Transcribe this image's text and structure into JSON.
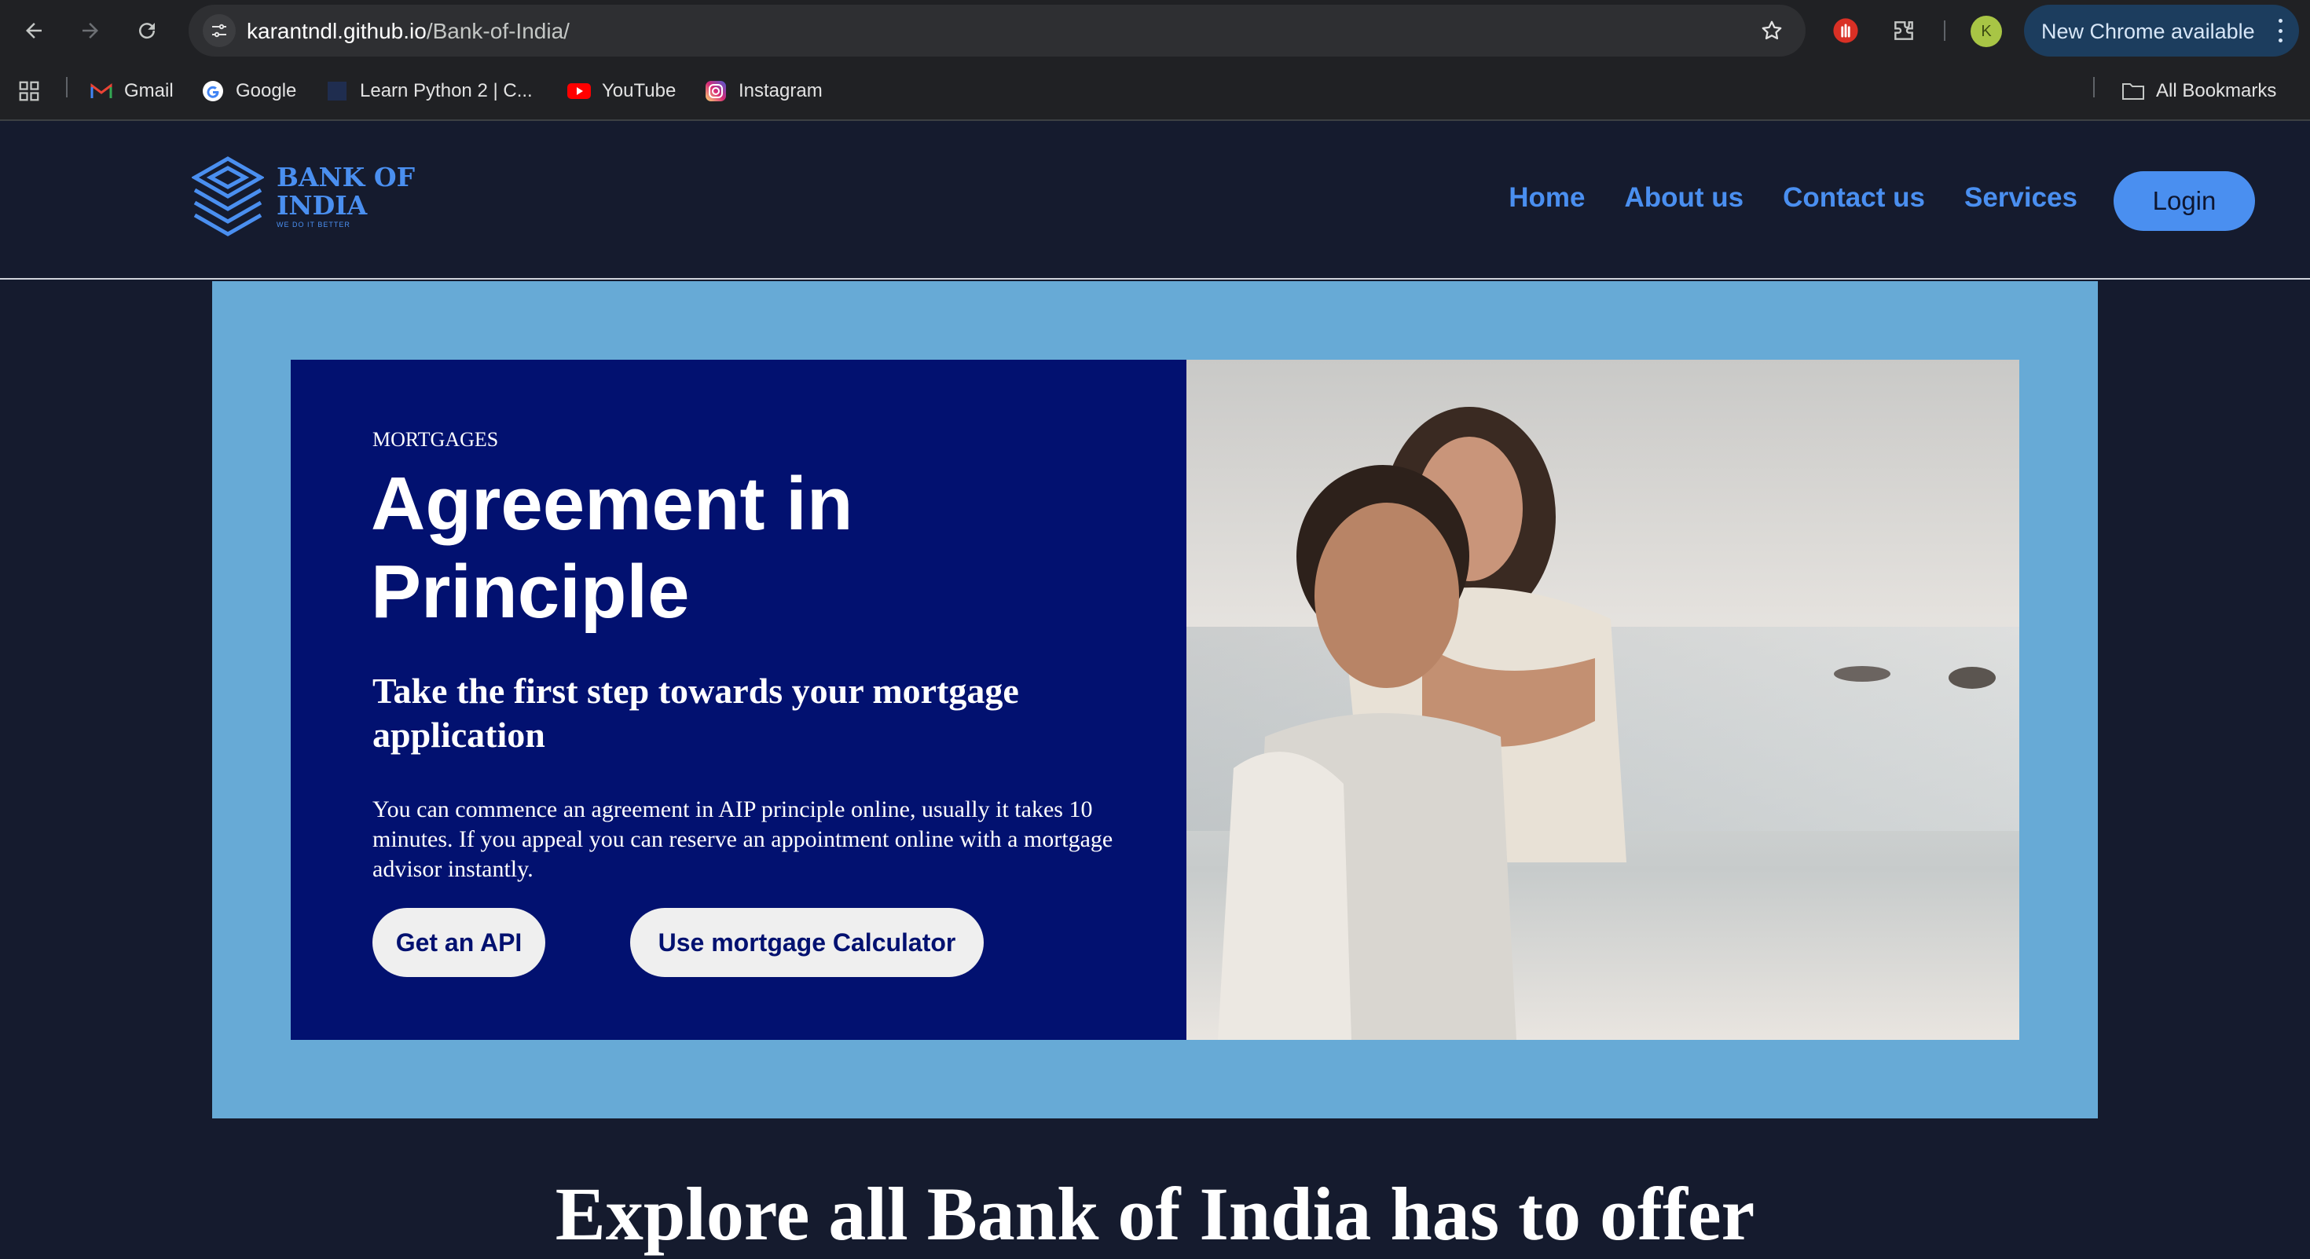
{
  "browser": {
    "url_host": "karantndl.github.io",
    "url_path": "/Bank-of-India/",
    "new_chrome_label": "New Chrome available",
    "avatar_initial": "K",
    "bookmarks": [
      {
        "label": "Gmail",
        "icon": "gmail-icon"
      },
      {
        "label": "Google",
        "icon": "google-icon"
      },
      {
        "label": "Learn Python 2 | C...",
        "icon": "codecademy-icon"
      },
      {
        "label": "YouTube",
        "icon": "youtube-icon"
      },
      {
        "label": "Instagram",
        "icon": "instagram-icon"
      }
    ],
    "all_bookmarks_label": "All Bookmarks"
  },
  "site": {
    "logo_line1": "BANK OF",
    "logo_line2": "INDIA",
    "logo_tagline": "WE DO IT BETTER",
    "nav": [
      "Home",
      "About us",
      "Contact us",
      "Services"
    ],
    "login_label": "Login"
  },
  "hero": {
    "eyebrow": "MORTGAGES",
    "title": "Agreement in Principle",
    "subtitle": "Take the first step towards your mortgage application",
    "body": "You can commence an agreement in AIP principle online, usually it takes 10 minutes. If you appeal you can reserve an appointment online with a mortgage advisor instantly.",
    "button_primary": "Get an API",
    "button_secondary": "Use mortgage Calculator",
    "image_subject": "smiling couple piggyback on beach"
  },
  "section": {
    "explore_heading": "Explore all Bank of India has to offer"
  },
  "colors": {
    "page_bg": "#151b2e",
    "accent_blue": "#4a8ff0",
    "hero_navy": "#021170",
    "hero_frame": "#67aad6"
  }
}
